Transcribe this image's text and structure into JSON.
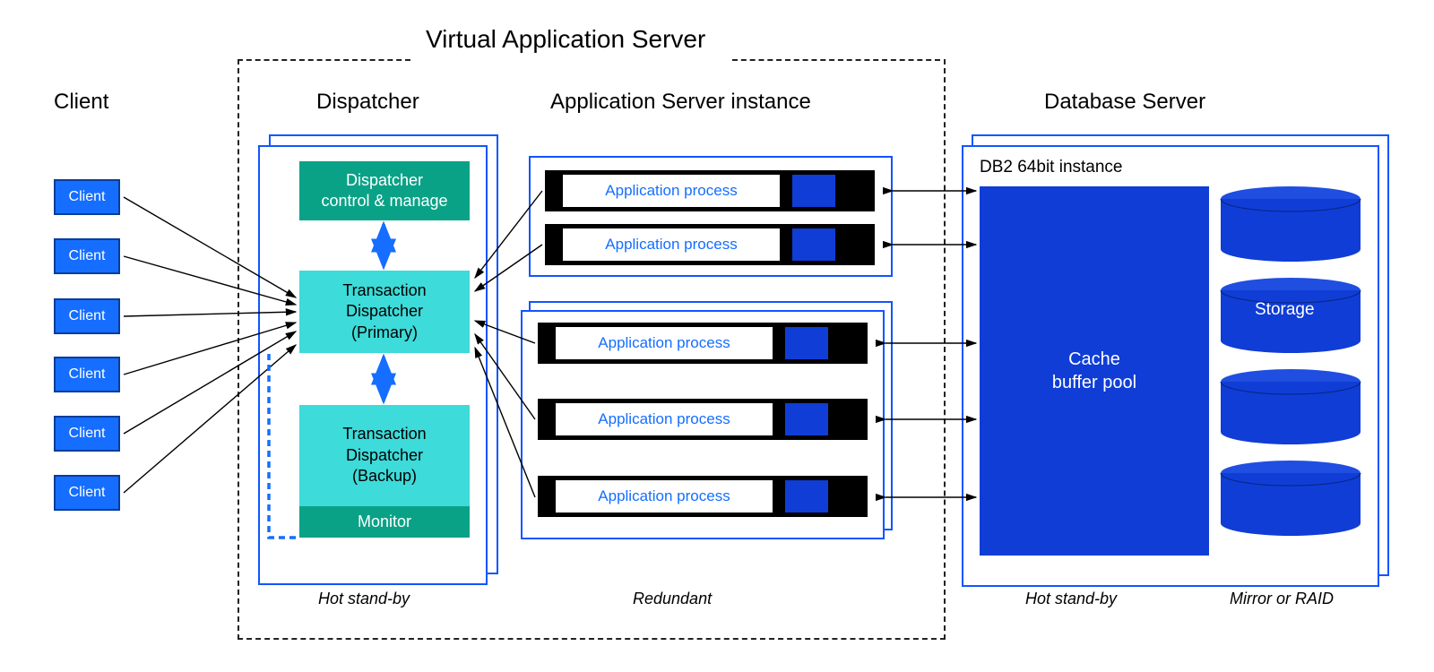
{
  "headers": {
    "vas": "Virtual Application Server",
    "client": "Client",
    "dispatcher": "Dispatcher",
    "asi": "Application Server instance",
    "dbserver": "Database Server"
  },
  "clients": [
    "Client",
    "Client",
    "Client",
    "Client",
    "Client",
    "Client"
  ],
  "dispatcher": {
    "control": "Dispatcher\ncontrol & manage",
    "primary": "Transaction\nDispatcher\n(Primary)",
    "backup": "Transaction\nDispatcher\n(Backup)",
    "monitor": "Monitor",
    "note": "Hot stand-by"
  },
  "asi": {
    "process": "Application process",
    "note": "Redundant"
  },
  "db": {
    "instance": "DB2 64bit instance",
    "cache": "Cache\nbuffer pool",
    "storage": "Storage",
    "note_left": "Hot stand-by",
    "note_right": "Mirror or RAID"
  }
}
